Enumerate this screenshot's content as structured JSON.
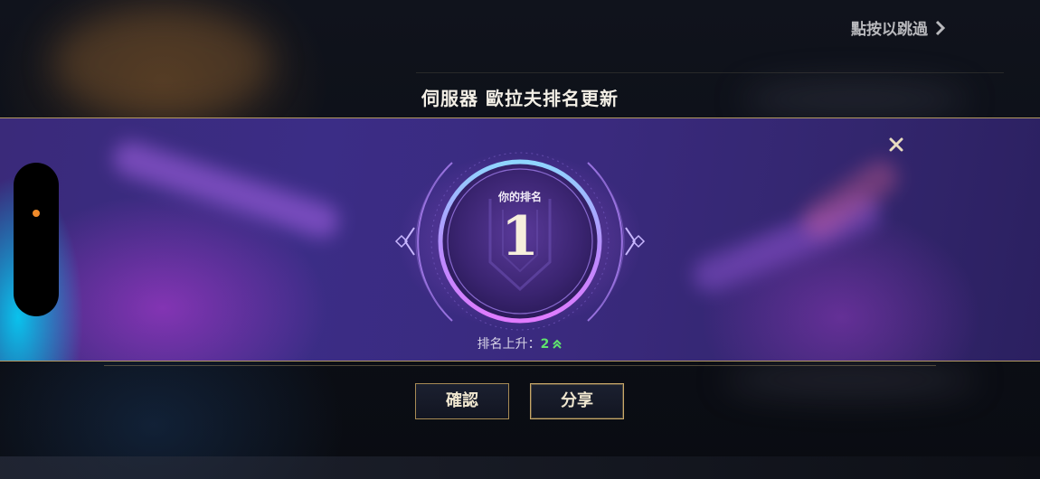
{
  "header": {
    "skip_label": "點按以跳過",
    "title": "伺服器 歐拉夫排名更新"
  },
  "rank_panel": {
    "caption": "你的排名",
    "rank": "1",
    "change_label": "排名上升：",
    "change_value": "2"
  },
  "buttons": {
    "confirm_label": "確認",
    "share_label": "分享"
  },
  "colors": {
    "accent_gold": "#b49a63",
    "band_purple": "#3a2a7a",
    "rank_up_green": "#5fe36d",
    "indicator_orange": "#f08a2a"
  },
  "icons": {
    "skip": "chevron-right-icon",
    "close": "close-icon",
    "rank_up": "double-chevron-up-icon"
  }
}
